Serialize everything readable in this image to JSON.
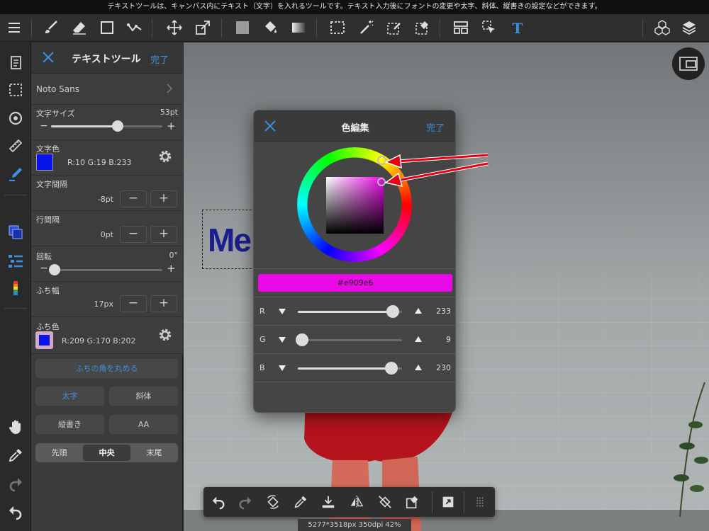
{
  "hint": "テキストツールは、キャンバス内にテキスト（文字）を入れるツールです。テキスト入力後にフォントの変更や太字、斜体、縦書きの設定などができます。",
  "panel": {
    "title": "テキストツール",
    "done": "完了",
    "font": "Noto Sans",
    "font_size_label": "文字サイズ",
    "font_size_value": "53pt",
    "font_size_level": 0.6,
    "text_color_label": "文字色",
    "text_color_value": "R:10 G:19 B:233",
    "text_color": "#0a13e9",
    "letter_spacing_label": "文字間隔",
    "letter_spacing_value": "-8pt",
    "line_spacing_label": "行間隔",
    "line_spacing_value": "0pt",
    "rotation_label": "回転",
    "rotation_value": "0°",
    "stroke_width_label": "ふち幅",
    "stroke_width_value": "17px",
    "stroke_color_label": "ふち色",
    "stroke_color_value": "R:209 G:170 B:202",
    "stroke_color": "#d1aaca",
    "round_corners": "ふちの角を丸める",
    "bold": "太字",
    "italic": "斜体",
    "vertical": "縦書き",
    "aa": "AA",
    "align_start": "先頭",
    "align_center": "中央",
    "align_end": "末尾",
    "minus": "−",
    "plus": "+"
  },
  "canvas": {
    "text_preview": "Me",
    "status": "5277*3518px 350dpi 42%"
  },
  "dialog": {
    "title": "色編集",
    "done": "完了",
    "hex": "#e909e6",
    "color": "#e909e6",
    "r_label": "R",
    "r_value": "233",
    "r_level": 0.91,
    "g_label": "G",
    "g_value": "9",
    "g_level": 0.04,
    "b_label": "B",
    "b_value": "230",
    "b_level": 0.9
  },
  "colors": {
    "accent": "#3d8fe0",
    "arrow": "#e60012",
    "panel_bg": "#3b3b3b",
    "dialog_bg": "#454545"
  }
}
